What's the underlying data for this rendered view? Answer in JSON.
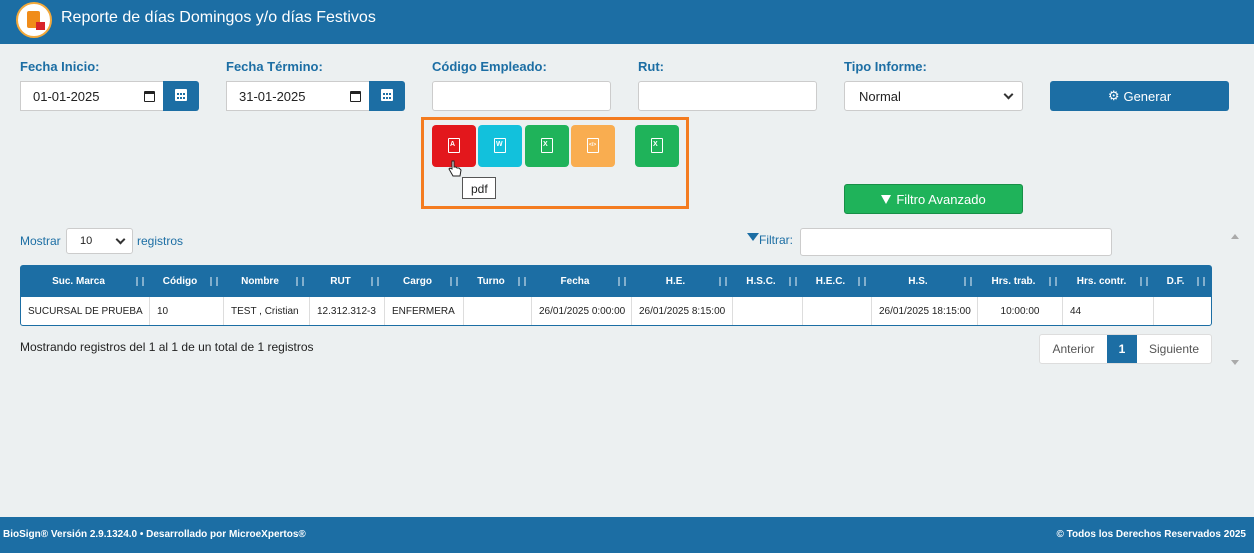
{
  "header": {
    "title": "Reporte de días Domingos y/o días Festivos",
    "logo_icon": "biosign-logo-icon"
  },
  "form": {
    "fecha_inicio": {
      "label": "Fecha Inicio:",
      "value": "01-01-2025"
    },
    "fecha_termino": {
      "label": "Fecha Término:",
      "value": "31-01-2025"
    },
    "codigo_empleado": {
      "label": "Código Empleado:",
      "value": ""
    },
    "rut": {
      "label": "Rut:",
      "value": ""
    },
    "tipo_informe": {
      "label": "Tipo Informe:",
      "selected": "Normal"
    },
    "generar_label": "Generar",
    "filtro_avanzado_label": "Filtro Avanzado"
  },
  "export": {
    "buttons": [
      {
        "name": "pdf",
        "glyph": "A",
        "color": "#e3171c"
      },
      {
        "name": "word",
        "glyph": "W",
        "color": "#12c1dc"
      },
      {
        "name": "excel",
        "glyph": "X",
        "color": "#1fb35a"
      },
      {
        "name": "xml",
        "glyph": "</>",
        "color": "#f9ad50"
      },
      {
        "name": "excel-alt",
        "glyph": "X",
        "color": "#1fb35a"
      }
    ],
    "tooltip": "pdf"
  },
  "table_controls": {
    "mostrar": "Mostrar",
    "page_size": "10",
    "registros": "registros",
    "filtrar": "Filtrar:"
  },
  "table": {
    "columns": [
      "Suc. Marca",
      "Código",
      "Nombre",
      "RUT",
      "Cargo",
      "Turno",
      "Fecha",
      "H.E.",
      "H.S.C.",
      "H.E.C.",
      "H.S.",
      "Hrs. trab.",
      "Hrs. contr.",
      "D.F."
    ],
    "rows": [
      [
        "SUCURSAL DE PRUEBA",
        "10",
        "TEST , Cristian",
        "12.312.312-3",
        "ENFERMERA",
        "",
        "26/01/2025 0:00:00",
        "26/01/2025 8:15:00",
        "",
        "",
        "26/01/2025 18:15:00",
        "10:00:00",
        "44",
        ""
      ]
    ]
  },
  "info": "Mostrando registros del 1 al 1 de un total de 1 registros",
  "pagination": {
    "prev": "Anterior",
    "current": "1",
    "next": "Siguiente"
  },
  "footer": {
    "left": "BioSign® Versión 2.9.1324.0 • Desarrollado por MicroeXpertos®",
    "right": "© Todos los Derechos Reservados 2025"
  }
}
